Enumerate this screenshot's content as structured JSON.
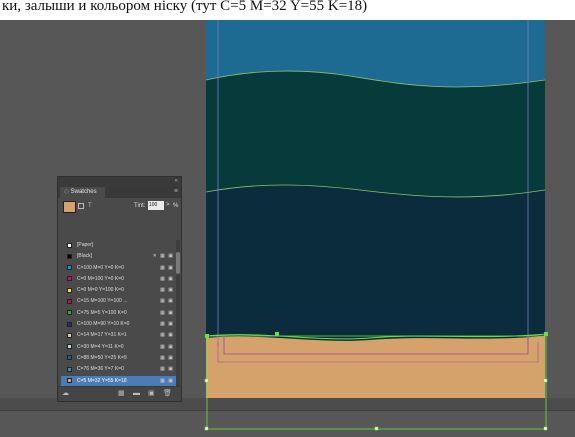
{
  "caption": {
    "text": "ки, залыши и кольором ніску (тут C=5 M=32 Y=55 K=18)"
  },
  "swatches_panel": {
    "tab_label": "Swatches",
    "collapse_icon": "«",
    "panel_menu_icon": "≡",
    "tint_label": "Tint:",
    "tint_value": "100",
    "tint_arrow": ">",
    "tint_percent": "%",
    "text_toggle_label": "T",
    "fill_color": "#d6a26c",
    "rows": [
      {
        "label": "[Paper]",
        "color": "#ffffff",
        "icons": ""
      },
      {
        "label": "[Black]",
        "color": "#000000",
        "icons": "✕ ▦ ▣"
      },
      {
        "label": "C=100 M=0 Y=0 K=0",
        "color": "#00a0e0",
        "icons": "▦ ▣"
      },
      {
        "label": "C=0 M=100 Y=0 K=0",
        "color": "#e3007e",
        "icons": "▦ ▣"
      },
      {
        "label": "C=0 M=0 Y=100 K=0",
        "color": "#ffe600",
        "icons": "▦ ▣"
      },
      {
        "label": "C=15 M=100 Y=100 ...",
        "color": "#c8102e",
        "icons": "▦ ▣"
      },
      {
        "label": "C=75 M=5 Y=100 K=0",
        "color": "#3aa535",
        "icons": "▦ ▣"
      },
      {
        "label": "C=100 M=90 Y=10 K=0",
        "color": "#1f2f86",
        "icons": "▦ ▣"
      },
      {
        "label": "C=14 M=17 Y=31 K=1",
        "color": "#d9cbae",
        "icons": "▦ ▣"
      },
      {
        "label": "C=30 M=4 Y=11 K=0",
        "color": "#b0d8e0",
        "icons": "▦ ▣"
      },
      {
        "label": "C=88 M=50 Y=25 K=9",
        "color": "#1f6388",
        "icons": "▦ ▣"
      },
      {
        "label": "C=76 M=36 Y=7 K=0",
        "color": "#3f8cc5",
        "icons": "▦ ▣"
      },
      {
        "label": "C=5 M=32 Y=55 K=18",
        "color": "#d6a26c",
        "icons": "▦ ▣",
        "selected": true
      }
    ],
    "footer_icons": [
      "cloud-icon",
      "grid-view-icon",
      "folder-icon",
      "new-swatch-icon",
      "trash-icon"
    ]
  },
  "colors": {
    "pasteboard": "#575757",
    "sky": "#1d6b92",
    "sea_green": "#073b3b",
    "deep_water": "#0b2c3c",
    "sand": "#d6a26c",
    "selection": "#6ae042",
    "margin_guide": "#9a4aa0"
  }
}
